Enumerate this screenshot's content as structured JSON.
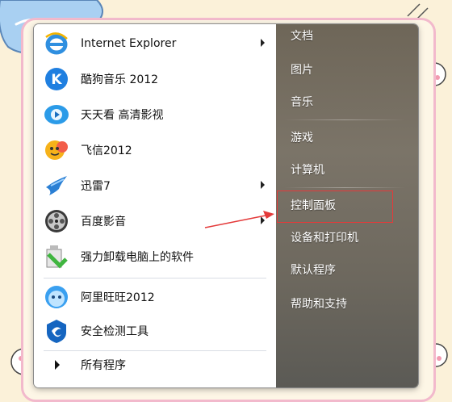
{
  "left_pane": {
    "programs": [
      {
        "label": "Internet Explorer",
        "icon": "internet-explorer-icon",
        "submenu": true
      },
      {
        "label": "酷狗音乐 2012",
        "icon": "kugou-music-icon",
        "submenu": false
      },
      {
        "label": "天天看 高清影视",
        "icon": "tiantiankan-icon",
        "submenu": false
      },
      {
        "label": "飞信2012",
        "icon": "fetion-icon",
        "submenu": false
      },
      {
        "label": "迅雷7",
        "icon": "thunder-icon",
        "submenu": true
      },
      {
        "label": "百度影音",
        "icon": "baidu-player-icon",
        "submenu": true
      },
      {
        "label": "强力卸载电脑上的软件",
        "icon": "uninstaller-icon",
        "submenu": false
      },
      {
        "label": "阿里旺旺2012",
        "icon": "aliwangwang-icon",
        "submenu": false
      },
      {
        "label": "安全检测工具",
        "icon": "security-check-icon",
        "submenu": false
      }
    ],
    "all_programs_label": "所有程序"
  },
  "right_pane": {
    "items": [
      {
        "label": "文档"
      },
      {
        "label": "图片"
      },
      {
        "label": "音乐"
      },
      {
        "label": "游戏"
      },
      {
        "label": "计算机"
      },
      {
        "label": "控制面板"
      },
      {
        "label": "设备和打印机"
      },
      {
        "label": "默认程序"
      },
      {
        "label": "帮助和支持"
      }
    ]
  },
  "colors": {
    "highlight_border": "#e43a3a",
    "frame_pink": "#f2b9cc",
    "background": "#fbf1d9"
  }
}
